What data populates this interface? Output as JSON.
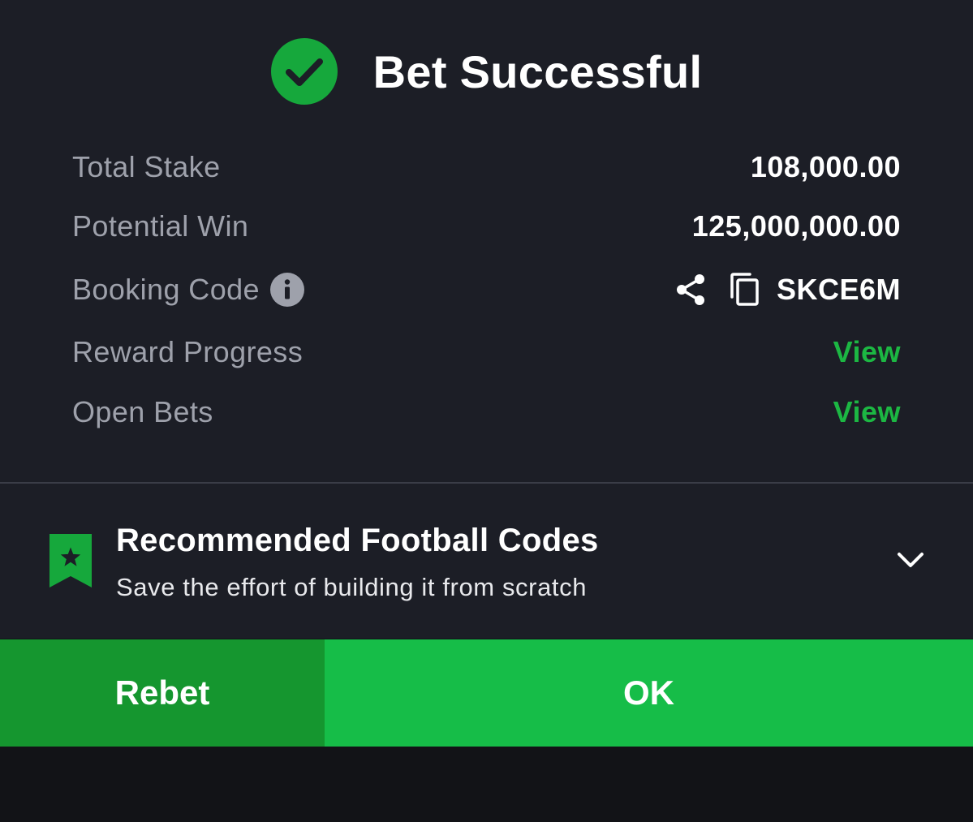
{
  "header": {
    "icon": "check-circle-icon",
    "title": "Bet Successful"
  },
  "details": {
    "total_stake": {
      "label": "Total Stake",
      "value": "108,000.00"
    },
    "potential_win": {
      "label": "Potential Win",
      "value": "125,000,000.00"
    },
    "booking_code": {
      "label": "Booking Code",
      "info_icon": "info-icon",
      "share_icon": "share-icon",
      "copy_icon": "copy-icon",
      "value": "SKCE6M"
    },
    "reward_progress": {
      "label": "Reward Progress",
      "link": "View"
    },
    "open_bets": {
      "label": "Open Bets",
      "link": "View"
    }
  },
  "recommended": {
    "icon": "bookmark-star-icon",
    "title": "Recommended Football Codes",
    "subtitle": "Save the effort of building it from scratch",
    "toggle_icon": "chevron-down-icon"
  },
  "actions": {
    "rebet_label": "Rebet",
    "ok_label": "OK"
  },
  "colors": {
    "accent_green": "#16bd48",
    "secondary_green": "#15962f",
    "link_green": "#1cb743",
    "panel_bg": "#1c1e26",
    "label_gray": "#9ea1ab"
  }
}
